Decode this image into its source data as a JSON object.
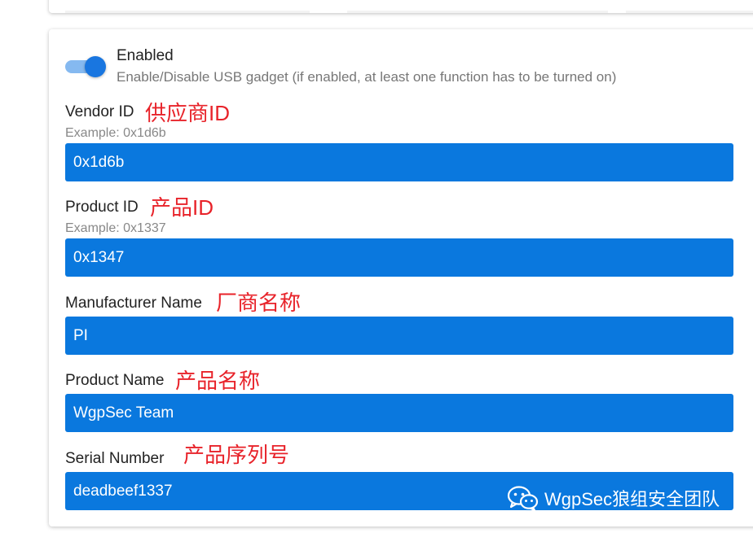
{
  "usb_gadget": {
    "enabled_label": "Enabled",
    "enabled_description": "Enable/Disable USB gadget (if enabled, at least one function has to be turned on)",
    "enabled": true,
    "fields": {
      "vendor_id": {
        "label": "Vendor ID",
        "annotation": "供应商ID",
        "example": "Example: 0x1d6b",
        "value": "0x1d6b"
      },
      "product_id": {
        "label": "Product ID",
        "annotation": "产品ID",
        "example": "Example: 0x1337",
        "value": "0x1347"
      },
      "manufacturer_name": {
        "label": "Manufacturer Name",
        "annotation": "厂商名称",
        "value": "PI"
      },
      "product_name": {
        "label": "Product Name",
        "annotation": "产品名称",
        "value": "WgpSec Team"
      },
      "serial_number": {
        "label": "Serial Number",
        "annotation": "产品序列号",
        "value": "deadbeef1337"
      }
    }
  },
  "watermark": {
    "text": "WgpSec狼组安全团队",
    "icon": "wechat-icon"
  },
  "colors": {
    "input_bg": "#0a78de",
    "toggle_on": "#1976e0",
    "annotation_red": "#e8232a"
  }
}
